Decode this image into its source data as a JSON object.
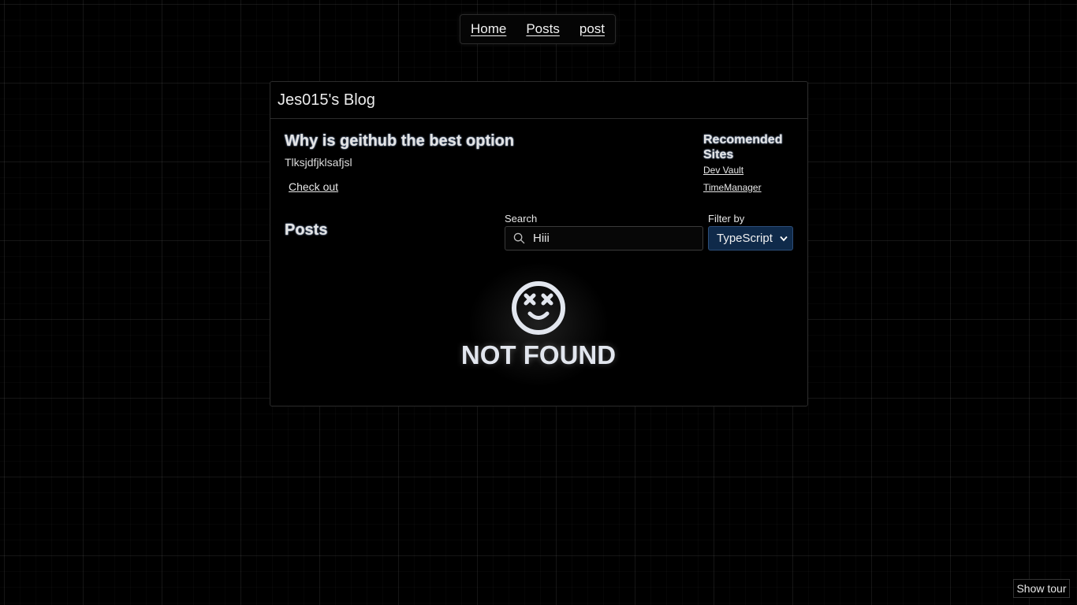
{
  "nav": {
    "links": [
      {
        "label": "Home"
      },
      {
        "label": "Posts"
      },
      {
        "label": "post"
      }
    ]
  },
  "blog": {
    "title": "Jes015's Blog"
  },
  "post": {
    "title": "Why is geithub the best option",
    "description": "Tlksjdfjklsafjsl",
    "cta_label": "Check out"
  },
  "recommended": {
    "heading": "Recomended Sites",
    "links": [
      {
        "label": "Dev Vault"
      },
      {
        "label": "TimeManager"
      }
    ]
  },
  "posts_section": {
    "heading": "Posts",
    "search": {
      "label": "Search",
      "value": "Hiii",
      "icon": "search-icon"
    },
    "filter": {
      "label": "Filter by",
      "selected": "TypeScript",
      "icon": "chevron-down-icon"
    },
    "empty_state": {
      "icon": "dizzy-face-icon",
      "text": "NOT FOUND"
    }
  },
  "tour": {
    "label": "Show tour"
  },
  "colors": {
    "background": "#000000",
    "text": "#e6e6e6",
    "select_bg": "#0f2a4a",
    "heading_glow": "#8fa6c9"
  }
}
